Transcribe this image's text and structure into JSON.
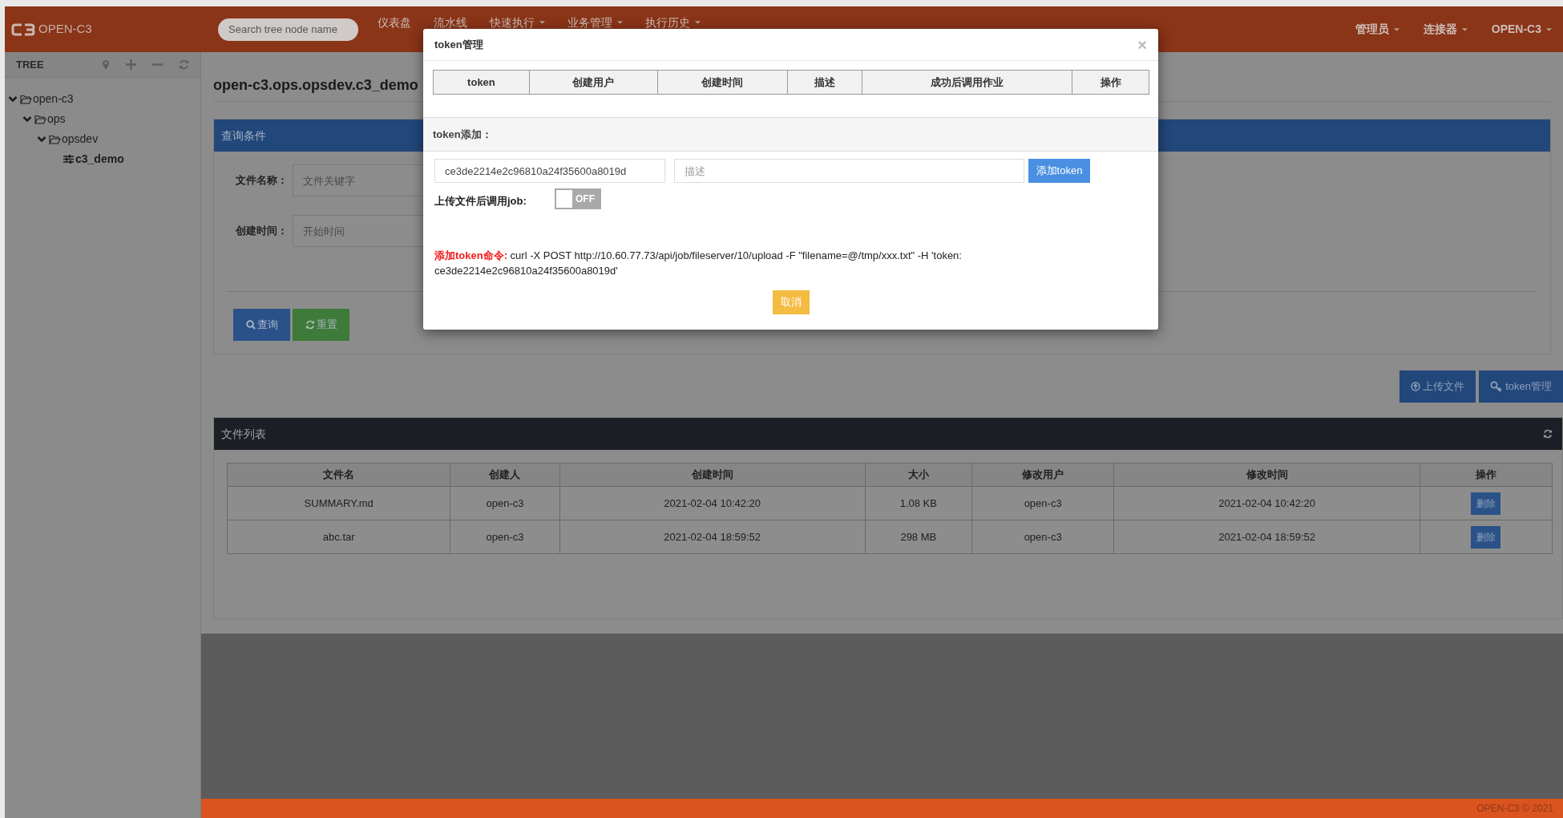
{
  "header": {
    "logo": "OPEN-C3",
    "search": {
      "placeholder": "Search tree node name"
    },
    "nav": [
      {
        "label": "仪表盘",
        "dropdown": false
      },
      {
        "label": "流水线",
        "dropdown": false
      },
      {
        "label": "快速执行",
        "dropdown": true
      },
      {
        "label": "业务管理",
        "dropdown": true
      },
      {
        "label": "执行历史",
        "dropdown": true
      }
    ],
    "right_menu": [
      {
        "label": "管理员",
        "dropdown": true
      },
      {
        "label": "连接器",
        "dropdown": true
      },
      {
        "label": "OPEN-C3",
        "dropdown": true
      }
    ]
  },
  "sidebar": {
    "title": "TREE",
    "tree": [
      {
        "label": "open-c3",
        "expanded": true,
        "selected": false,
        "children": [
          {
            "label": "ops",
            "expanded": true,
            "selected": false,
            "children": [
              {
                "label": "opsdev",
                "expanded": true,
                "selected": false,
                "children": [
                  {
                    "label": "c3_demo",
                    "selected": true
                  }
                ]
              }
            ]
          }
        ]
      }
    ]
  },
  "main": {
    "breadcrumb": "open-c3.ops.opsdev.c3_demo",
    "query_panel": {
      "title": "查询条件",
      "fields": [
        {
          "label": "文件名称：",
          "placeholder": "文件关键字"
        },
        {
          "label": "创建时间：",
          "placeholder": "开始时间"
        }
      ],
      "buttons": [
        {
          "label": "查询",
          "kind": "search"
        },
        {
          "label": "重置",
          "kind": "reset"
        }
      ]
    },
    "actions": [
      {
        "label": "上传文件",
        "kind": "upload"
      },
      {
        "label": "token管理",
        "kind": "key"
      }
    ],
    "file_list": {
      "title": "文件列表",
      "columns": [
        "文件名",
        "创建人",
        "创建时间",
        "大小",
        "修改用户",
        "修改时间",
        "操作"
      ],
      "rows": [
        {
          "cells": [
            "SUMMARY.md",
            "open-c3",
            "2021-02-04 10:42:20",
            "1.08 KB",
            "open-c3",
            "2021-02-04 10:42:20"
          ],
          "action": "删除"
        },
        {
          "cells": [
            "abc.tar",
            "open-c3",
            "2021-02-04 18:59:52",
            "298 MB",
            "open-c3",
            "2021-02-04 18:59:52"
          ],
          "action": "删除"
        }
      ]
    }
  },
  "footer": "OPEN-C3 © 2021",
  "modal": {
    "title": "token管理",
    "close": "×",
    "columns": [
      "token",
      "创建用户",
      "创建时间",
      "描述",
      "成功后调用作业",
      "操作"
    ],
    "add_section": {
      "title": "token添加：",
      "token_value": "ce3de2214e2c96810a24f35600a8019d",
      "description_placeholder": "描述",
      "add_button": "添加token",
      "toggle": {
        "label": "上传文件后调用job:",
        "on": false,
        "state_text": "OFF"
      },
      "command": "**添加token命令:** curl -X POST http://10.60.77.73/api/job/fileserver/10/upload -F \"filename=@/tmp/xxx.txt\" -H 'token: ce3de2214e2c96810a24f35600a8019d'"
    },
    "cancel_button": "取消"
  }
}
